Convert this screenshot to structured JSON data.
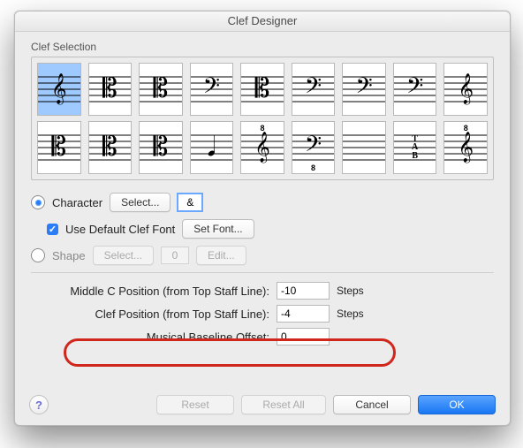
{
  "window": {
    "title": "Clef Designer"
  },
  "clef_selection": {
    "label": "Clef Selection",
    "selected_index": 0,
    "cells": [
      {
        "glyph": "𝄞",
        "sup": "",
        "sub": ""
      },
      {
        "glyph": "𝄡",
        "sup": "",
        "sub": ""
      },
      {
        "glyph": "𝄡",
        "sup": "",
        "sub": ""
      },
      {
        "glyph": "𝄢",
        "sup": "",
        "sub": ""
      },
      {
        "glyph": "𝄡",
        "sup": "",
        "sub": ""
      },
      {
        "glyph": "𝄢",
        "sup": "",
        "sub": ""
      },
      {
        "glyph": "𝄢",
        "sup": "",
        "sub": ""
      },
      {
        "glyph": "𝄢",
        "sup": "",
        "sub": ""
      },
      {
        "glyph": "𝄞",
        "sup": "",
        "sub": ""
      },
      {
        "glyph": "𝄡",
        "sup": "",
        "sub": ""
      },
      {
        "glyph": "𝄡",
        "sup": "",
        "sub": ""
      },
      {
        "glyph": "𝄡",
        "sup": "",
        "sub": ""
      },
      {
        "glyph": "𝅘𝅥",
        "sup": "",
        "sub": ""
      },
      {
        "glyph": "𝄞",
        "sup": "8",
        "sub": ""
      },
      {
        "glyph": "𝄢",
        "sup": "",
        "sub": "8"
      },
      {
        "glyph": "",
        "sup": "",
        "sub": ""
      },
      {
        "glyph": "",
        "sup": "",
        "sub": "",
        "tab": true
      },
      {
        "glyph": "𝄞",
        "sup": "8",
        "sub": ""
      }
    ]
  },
  "character": {
    "radio_label": "Character",
    "select_label": "Select...",
    "value": "&",
    "use_default_font_label": "Use Default Clef Font",
    "use_default_font_checked": true,
    "set_font_label": "Set Font..."
  },
  "shape": {
    "radio_label": "Shape",
    "select_label": "Select...",
    "value": "0",
    "edit_label": "Edit..."
  },
  "fields": {
    "middle_c_label": "Middle C Position (from Top Staff Line):",
    "middle_c_value": "-10",
    "clef_pos_label": "Clef Position (from Top Staff Line):",
    "clef_pos_value": "-4",
    "baseline_label": "Musical Baseline Offset:",
    "baseline_value": "0",
    "units": "Steps"
  },
  "footer": {
    "help": "?",
    "reset": "Reset",
    "reset_all": "Reset All",
    "cancel": "Cancel",
    "ok": "OK"
  }
}
